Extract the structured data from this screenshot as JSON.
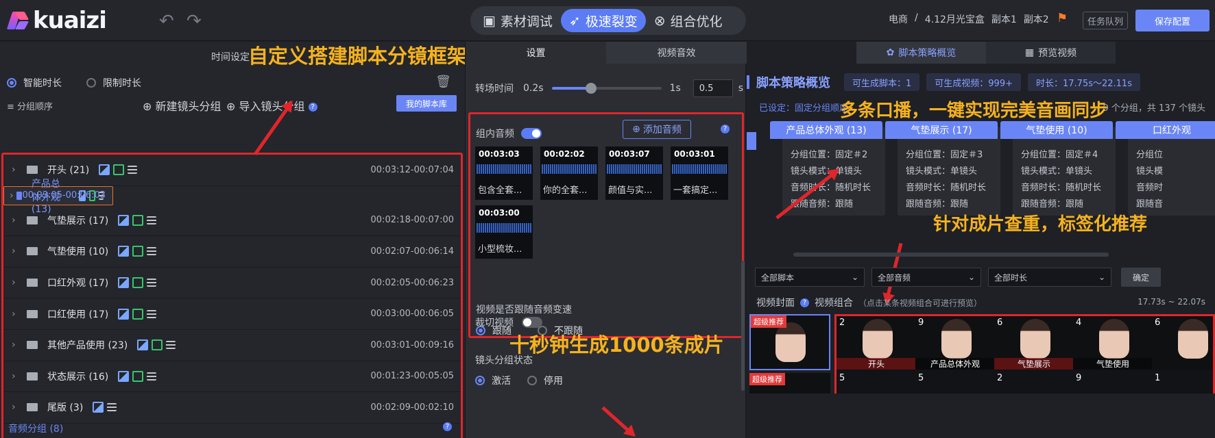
{
  "app": {
    "logo": "kuaizi",
    "modes": [
      {
        "label": "素材调试",
        "icon": "film-icon",
        "active": false
      },
      {
        "label": "极速裂变",
        "icon": "rocket-icon",
        "active": true
      },
      {
        "label": "组合优化",
        "icon": "combine-icon",
        "active": false
      }
    ],
    "breadcrumb": [
      "电商",
      "/",
      "4.12月光宝盒",
      "副本1",
      "副本2"
    ],
    "task_queue": "任务队列",
    "save_config": "保存配置"
  },
  "annotations": {
    "a1": "自定义搭建脚本分镜框架",
    "a2": "多条口播，一键实现完美音画同步",
    "a3": "针对成片查重，标签化推荐",
    "a4": "十秒钟生成1000条成片"
  },
  "left": {
    "time_setting": "时间设定",
    "smart_duration": "智能时长",
    "limit_duration": "限制时长",
    "sort_label": "分组顺序",
    "new_group": "新建镜头分组",
    "import_group": "导入镜头分组",
    "my_library": "我的脚本库",
    "groups": [
      {
        "name": "开头 (21)",
        "time": "00:03:12-00:07:04",
        "selected": false,
        "aud": true
      },
      {
        "name": "产品总体外观 (13)",
        "time": "00:03:05-00:06:03",
        "selected": true,
        "aud": true
      },
      {
        "name": "气垫展示 (17)",
        "time": "00:02:18-00:07:00",
        "selected": false,
        "aud": true
      },
      {
        "name": "气垫使用 (10)",
        "time": "00:02:07-00:06:14",
        "selected": false,
        "aud": true
      },
      {
        "name": "口红外观 (17)",
        "time": "00:02:05-00:06:23",
        "selected": false,
        "aud": true
      },
      {
        "name": "口红使用 (17)",
        "time": "00:03:00-00:06:05",
        "selected": false,
        "aud": true
      },
      {
        "name": "其他产品使用 (23)",
        "time": "00:03:01-00:09:16",
        "selected": false,
        "aud": true
      },
      {
        "name": "状态展示 (16)",
        "time": "00:01:23-00:05:05",
        "selected": false,
        "aud": true
      },
      {
        "name": "尾版 (3)",
        "time": "00:02:09-00:02:10",
        "selected": false,
        "aud": false
      }
    ],
    "audio_group": "音频分组 (8)"
  },
  "mid": {
    "tabs": [
      "设置",
      "视频音效"
    ],
    "transition_label": "转场时间",
    "transition_min": "0.2s",
    "transition_max": "1s",
    "transition_value": "0.5",
    "transition_unit": "s",
    "transition_fraction": 0.34,
    "in_group_audio": "组内音频",
    "add_audio": "添加音频",
    "clips": [
      {
        "time": "00:03:03",
        "name": "包含全套..."
      },
      {
        "time": "00:02:02",
        "name": "你的全套..."
      },
      {
        "time": "00:03:07",
        "name": "颜值与实..."
      },
      {
        "time": "00:03:01",
        "name": "一套搞定..."
      },
      {
        "time": "00:03:00",
        "name": "小型梳妆..."
      }
    ],
    "follow_label": "视频是否跟随音频变速",
    "follow": "跟随",
    "not_follow": "不跟随",
    "cut_video": "裁切视频",
    "shot_state": "镜头分组状态",
    "activate": "激活",
    "disable": "停用"
  },
  "right": {
    "tabs": [
      "脚本策略概览",
      "预览视频"
    ],
    "title": "脚本策略概览",
    "pills": [
      "可生成脚本：1",
      "可生成视频：999+",
      "时长：17.75s～22.11s"
    ],
    "set_fixed": "已设定：固定分组顺序",
    "group_count": "9 个分组，共 137 个镜头",
    "cards": [
      {
        "title": "产品总体外观 (13)",
        "pos": "分组位置：固定＃2",
        "mode": "镜头模式：单镜头",
        "dur": "音频时长：随机时长",
        "follow": "跟随音频：跟随"
      },
      {
        "title": "气垫展示 (17)",
        "pos": "分组位置：固定＃3",
        "mode": "镜头模式：单镜头",
        "dur": "音频时长：随机时长",
        "follow": "跟随音频：跟随"
      },
      {
        "title": "气垫使用 (10)",
        "pos": "分组位置：固定＃4",
        "mode": "镜头模式：单镜头",
        "dur": "音频时长：随机时长",
        "follow": "跟随音频：跟随"
      },
      {
        "title": "口红外观",
        "pos": "分组位",
        "mode": "镜头模",
        "dur": "音频时",
        "follow": "跟随音"
      }
    ],
    "filters": [
      "全部脚本",
      "全部音频",
      "全部时长"
    ],
    "confirm": "确定",
    "video_cover": "视频封面",
    "video_combo": "视频组合",
    "combo_hint": "（点击某条视频组合可进行预览）",
    "dur_range": "17.73s ~ 22.07s",
    "super_rec": "超级推荐",
    "row1": [
      {
        "n": "2",
        "label": "开头"
      },
      {
        "n": "9",
        "label": "产品总体外观"
      },
      {
        "n": "6",
        "label": "气垫展示"
      },
      {
        "n": "4",
        "label": "气垫使用"
      },
      {
        "n": "6",
        "label": ""
      }
    ],
    "row2": [
      "5",
      "5",
      "2",
      "9",
      "1"
    ]
  }
}
